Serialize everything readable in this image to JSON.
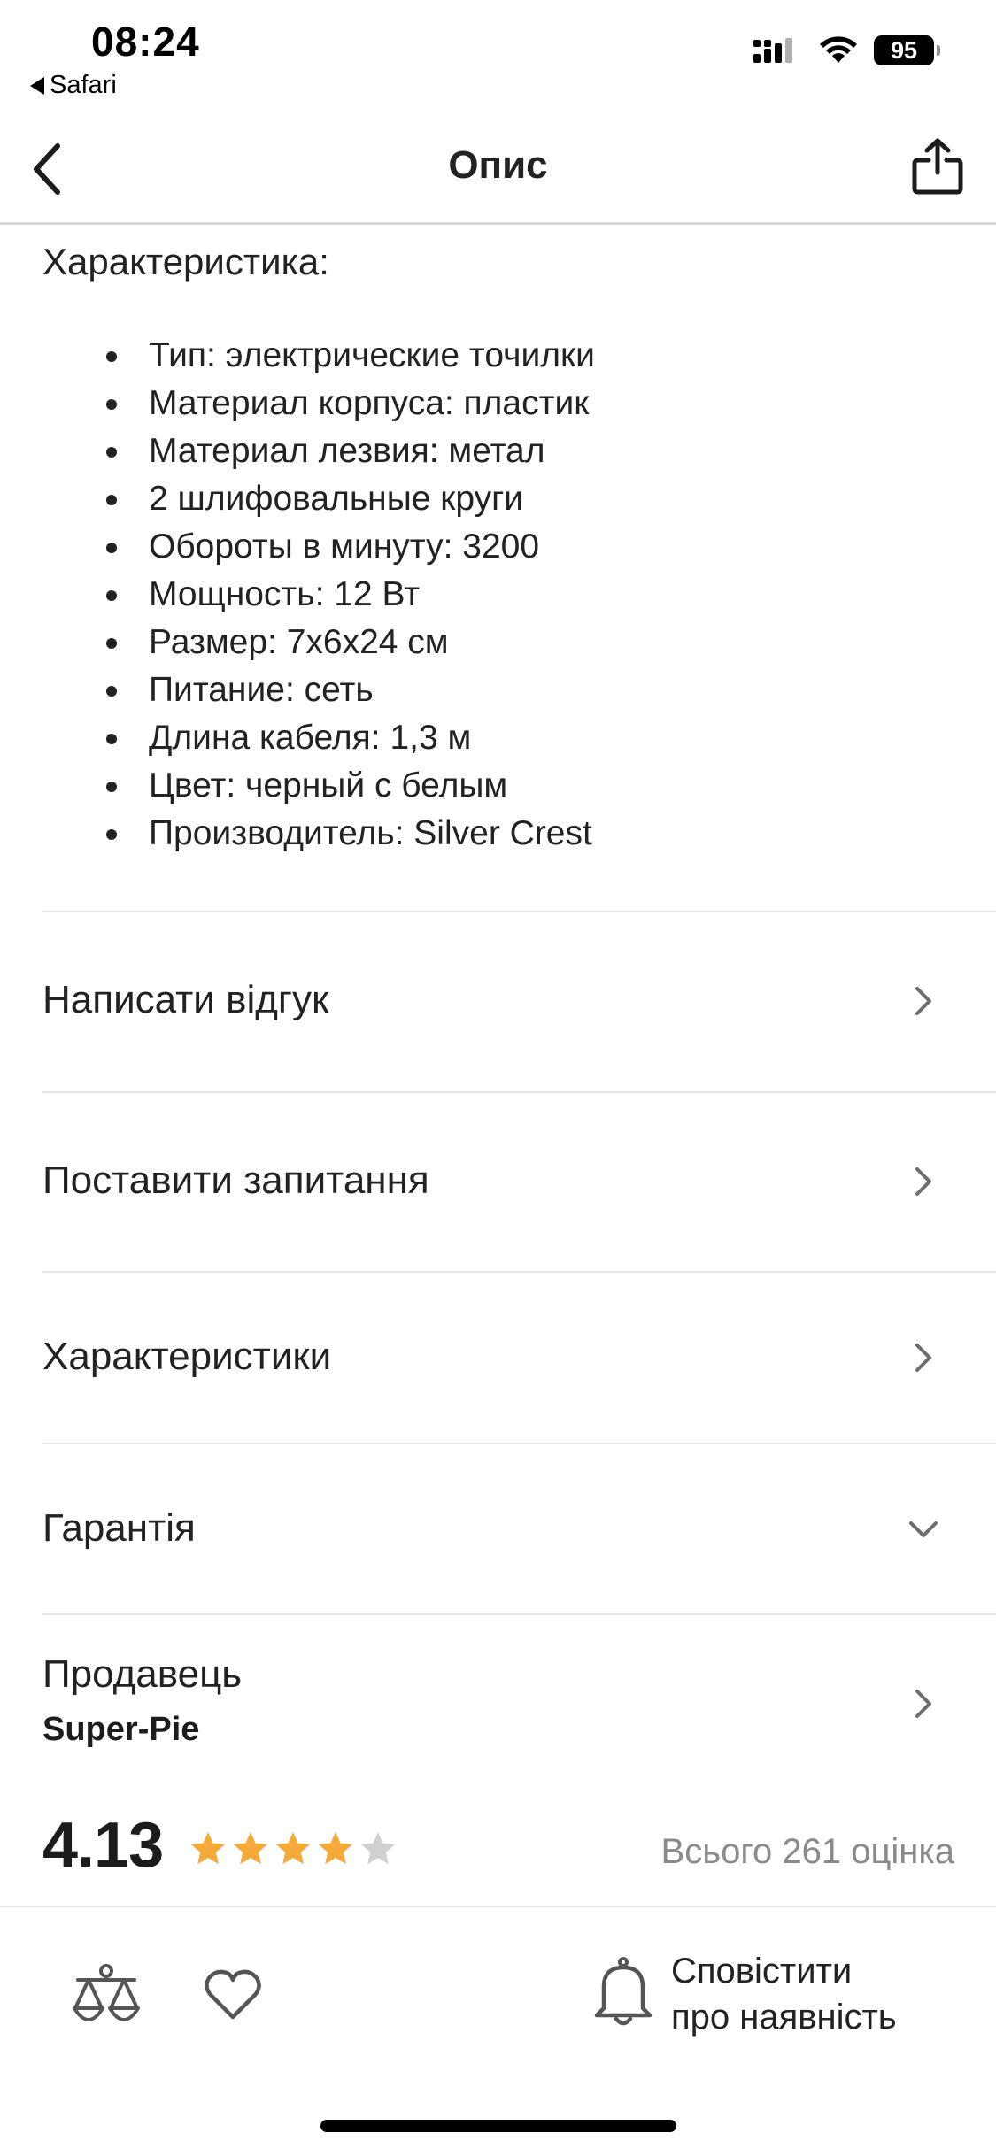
{
  "status_bar": {
    "time": "08:24",
    "back_app": "Safari",
    "battery": "95",
    "icons": [
      "signal-icon",
      "wifi-icon",
      "battery-icon"
    ]
  },
  "header": {
    "title": "Опис",
    "back_icon": "chevron-left-icon",
    "share_icon": "share-icon"
  },
  "description": {
    "heading": "Характеристика:",
    "specs": [
      "Тип: электрические точилки",
      "Материал корпуса: пластик",
      "Материал лезвия: метал",
      "2 шлифовальные круги",
      "Обороты в минуту: 3200",
      "Мощность: 12 Вт",
      "Размер: 7x6x24 см",
      "Питание: сеть",
      "Длина кабеля: 1,3 м",
      "Цвет: черный с белым",
      "Производитель: Silver Crest"
    ]
  },
  "rows": {
    "review": "Написати відгук",
    "question": "Поставити запитання",
    "characteristics": "Характеристики",
    "warranty": "Гарантія",
    "seller_label": "Продавець",
    "seller_name": "Super-Pie"
  },
  "rating": {
    "value": "4.13",
    "stars_filled": 4,
    "stars_total": 5,
    "star_color": "#f4a938",
    "star_empty_color": "#d0d0d0",
    "count_text": "Всього 261 оцінка"
  },
  "bottom_bar": {
    "notify_line1": "Сповістити",
    "notify_line2": "про наявність",
    "icons": [
      "compare-scales-icon",
      "heart-icon",
      "bell-icon"
    ]
  }
}
